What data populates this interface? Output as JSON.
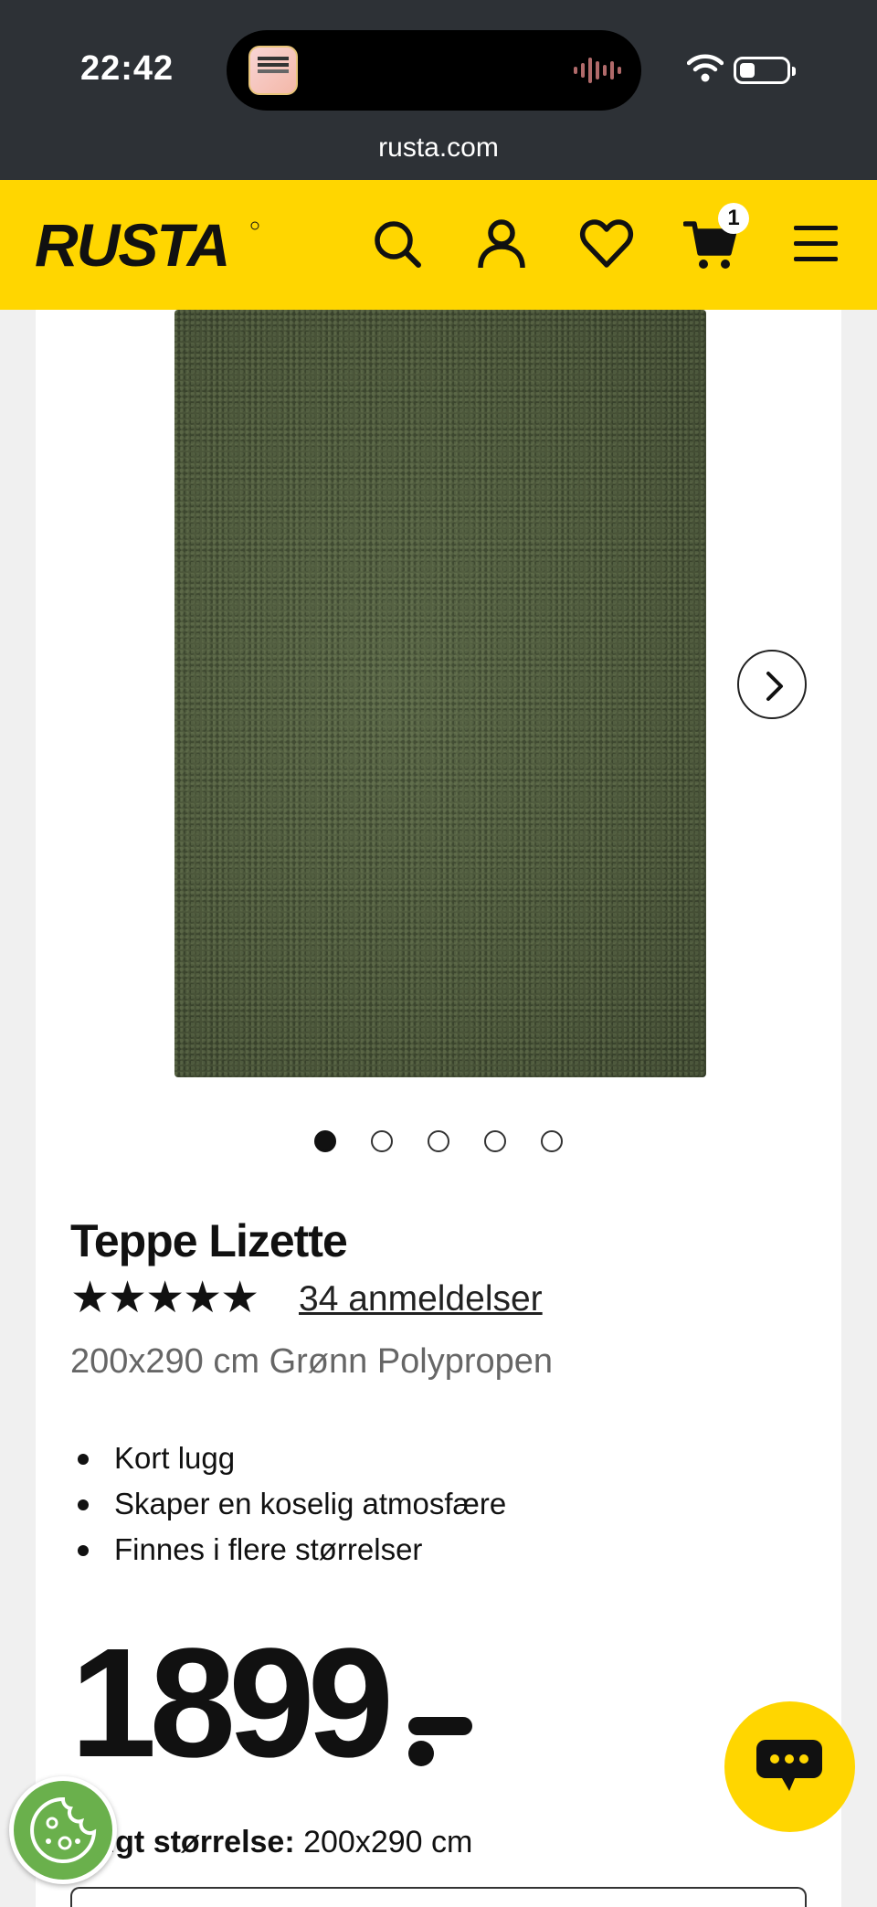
{
  "status_bar": {
    "time": "22:42",
    "url": "rusta.com"
  },
  "header": {
    "logo_text": "RUSTA",
    "cart_count": "1",
    "brand_color": "#ffd600",
    "icons": [
      "search-icon",
      "account-icon",
      "heart-icon",
      "cart-icon",
      "menu-icon"
    ]
  },
  "product": {
    "title": "Teppe Lizette",
    "stars": "★★★★★",
    "reviews_label": "34 anmeldelser",
    "variant": "200x290 cm Grønn Polypropen",
    "features": [
      "Kort lugg",
      "Skaper en koselig atmosfære",
      "Finnes i flere størrelser"
    ],
    "price": "1899",
    "size_label": "Valgt størrelse:",
    "size_value": "200x290 cm",
    "gallery": {
      "image_count": 5,
      "active_index": 0
    }
  },
  "floating": {
    "chat_icon": "chat-bubble-icon",
    "cookie_icon": "cookie-icon"
  }
}
